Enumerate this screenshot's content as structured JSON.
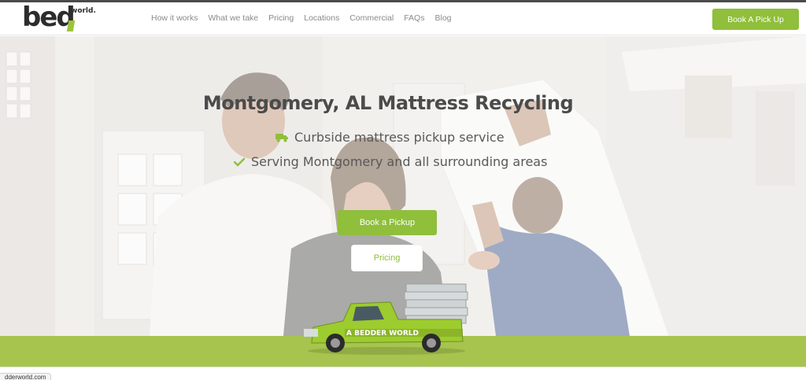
{
  "header": {
    "logo_text": "bed",
    "logo_sup": "world.",
    "nav": [
      "How it works",
      "What we take",
      "Pricing",
      "Locations",
      "Commercial",
      "FAQs",
      "Blog"
    ],
    "cta": "Book A Pick Up"
  },
  "hero": {
    "title": "Montgomery, AL Mattress Recycling",
    "features": [
      {
        "icon": "truck-icon",
        "text": "Curbside mattress pickup service"
      },
      {
        "icon": "check-icon",
        "text": "Serving Montgomery and all surrounding areas"
      }
    ],
    "primary_button": "Book a Pickup",
    "secondary_button": "Pricing",
    "truck_label": "A BEDDER WORLD"
  },
  "status_bar": {
    "url_fragment": "dderworld.com"
  },
  "colors": {
    "brand_green": "#8fbf3b",
    "band_green": "#a6c44e",
    "title_gray": "#4b4b4b"
  }
}
